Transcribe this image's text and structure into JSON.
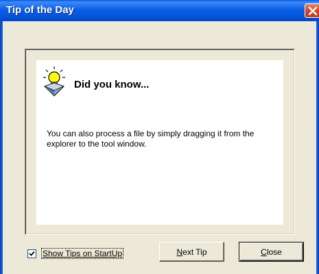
{
  "window": {
    "title": "Tip of the Day"
  },
  "tip": {
    "heading": "Did you know...",
    "text": "You can also process a file by simply dragging it from the explorer to the tool window."
  },
  "options": {
    "show_tips_label": "Show Tips on StartUp",
    "show_tips_checked": true
  },
  "buttons": {
    "next_tip_mnemonic": "N",
    "next_tip_rest": "ext Tip",
    "close_mnemonic": "C",
    "close_rest": "lose"
  },
  "colors": {
    "titlebar": "#0554dc",
    "close_button": "#d8472a",
    "dialog_background": "#ece9d8",
    "panel_background": "#ffffff"
  },
  "icons": {
    "close": "close-icon",
    "bulb": "lightbulb-icon",
    "check": "checkmark-icon"
  }
}
